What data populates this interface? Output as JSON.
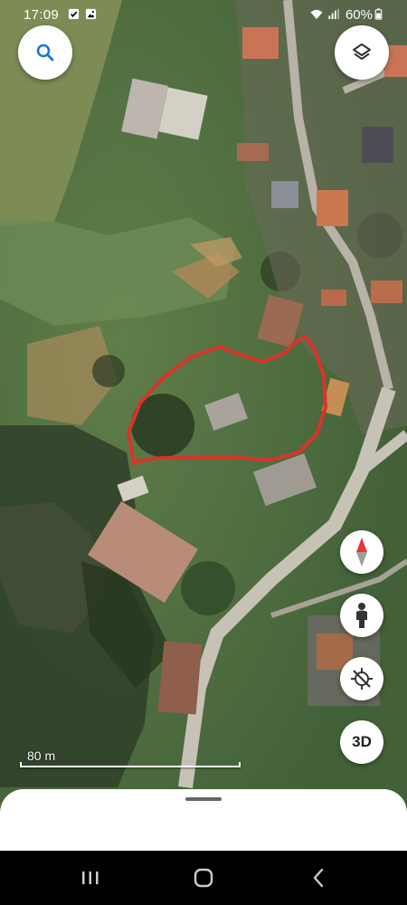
{
  "status_bar": {
    "time": "17:09",
    "battery_percent": "60%",
    "icons": [
      "check-box-icon",
      "image-icon",
      "wifi-icon",
      "signal-icon",
      "battery-icon"
    ]
  },
  "map": {
    "type": "satellite",
    "scale_label": "80 m",
    "highlight_color": "#d8342c"
  },
  "buttons": {
    "search": "search-icon",
    "layers": "layers-icon",
    "compass": "compass-icon",
    "street_view": "pegman-icon",
    "my_location": "location-off-icon",
    "view_3d_label": "3D"
  },
  "bottom_sheet": {
    "state": "collapsed"
  },
  "system_nav": [
    "recent-apps-icon",
    "home-icon",
    "back-icon"
  ]
}
